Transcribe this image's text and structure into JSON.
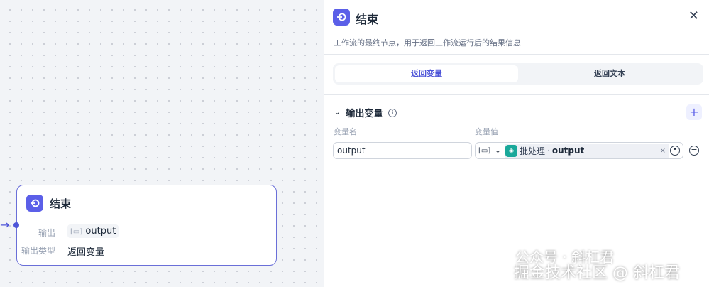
{
  "canvas": {
    "node": {
      "title": "结束",
      "output_label": "输出",
      "output_value": "output",
      "type_label": "输出类型",
      "type_value": "返回变量"
    }
  },
  "panel": {
    "title": "结束",
    "description": "工作流的最终节点，用于返回工作流运行后的结果信息",
    "tabs": [
      {
        "label": "返回变量",
        "active": true
      },
      {
        "label": "返回文本",
        "active": false
      }
    ],
    "section_title": "输出变量",
    "col_name": "变量名",
    "col_value": "变量值",
    "row": {
      "name": "output",
      "source_node": "批处理",
      "separator": "·",
      "source_var": "output"
    }
  },
  "watermark": {
    "line1": "公众号 · 斜杠君",
    "line2": "掘金技术社区 @ 斜杠君"
  },
  "colors": {
    "accent": "#5b5fe8",
    "node_border": "#6a6fd8",
    "iteration_icon": "#1aa89a"
  }
}
